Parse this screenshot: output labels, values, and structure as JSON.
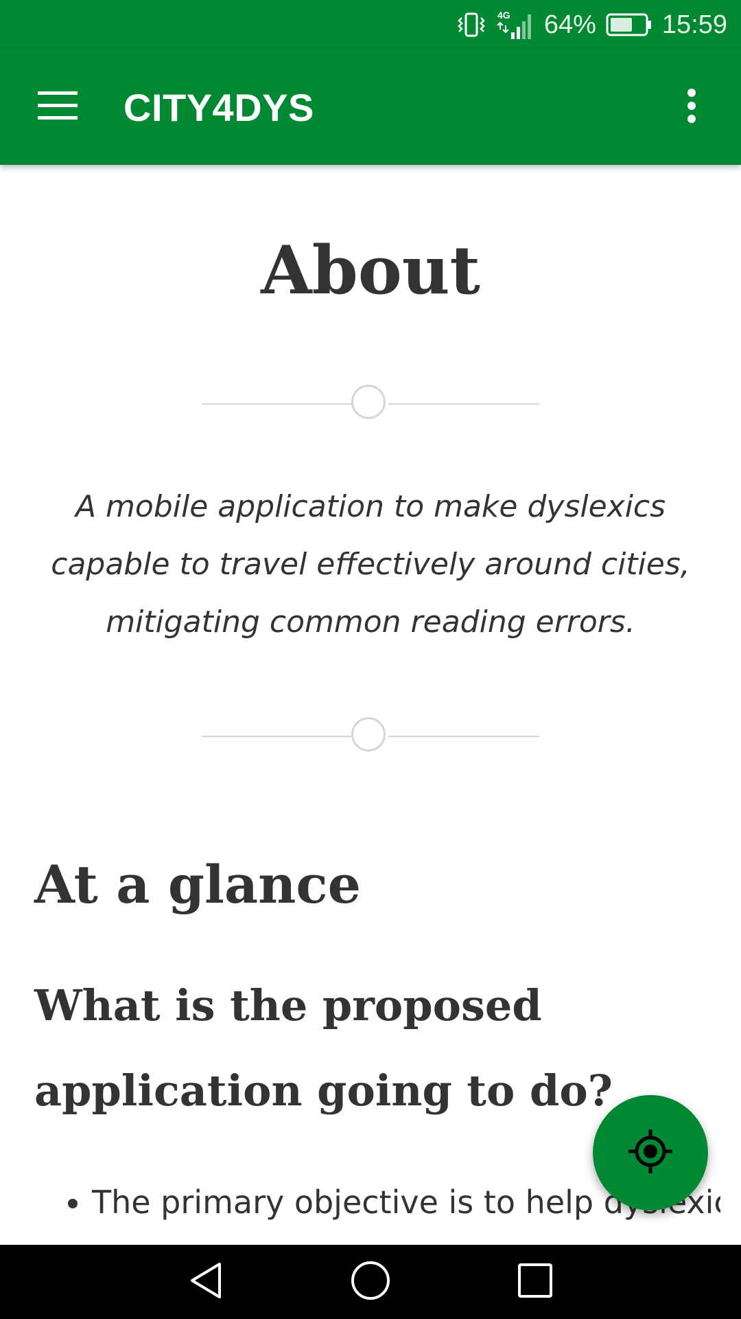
{
  "status_bar": {
    "network_label": "4G",
    "battery_percent": "64%",
    "time": "15:59",
    "battery_level": 0.64,
    "icons": [
      "vibrate-icon",
      "signal-icon",
      "battery-icon"
    ]
  },
  "app_bar": {
    "title": "CITY4DYS",
    "menu_icon": "hamburger-menu-icon",
    "overflow_icon": "more-vert-icon"
  },
  "content": {
    "page_title": "About",
    "tagline": "A mobile application to make dyslexics capable to travel effectively around cities, mitigating common reading errors.",
    "section_title": "At a glance",
    "sub_title": "What is the proposed application going to do?",
    "bullets": [
      "The primary objective is to help dyslexic"
    ]
  },
  "fab": {
    "icon": "my-location-icon"
  },
  "nav_bar": {
    "icons": [
      "back-icon",
      "home-icon",
      "recents-icon"
    ]
  },
  "colors": {
    "primary": "#008833",
    "text": "#333333",
    "divider": "#d6d6d6"
  }
}
